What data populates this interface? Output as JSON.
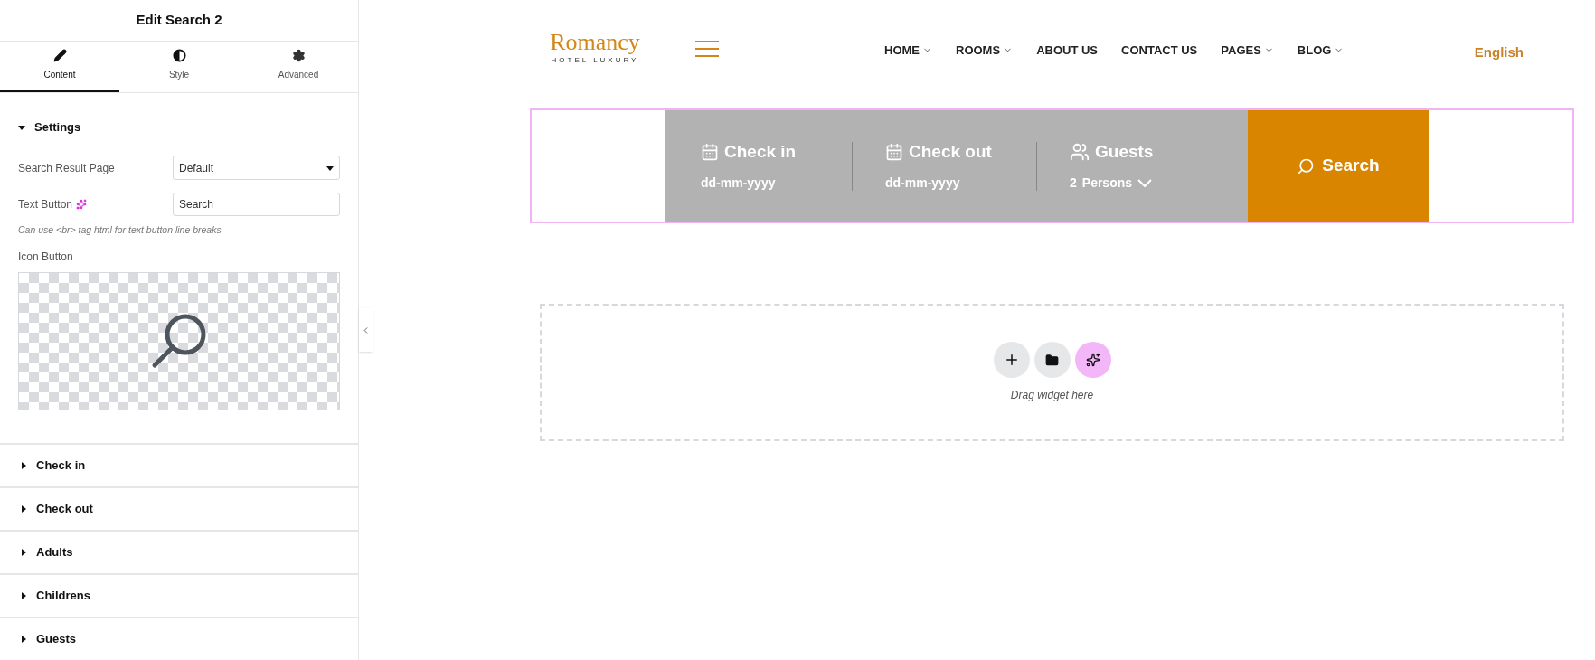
{
  "panel": {
    "title": "Edit Search 2",
    "tabs": [
      {
        "label": "Content",
        "selected": true
      },
      {
        "label": "Style",
        "selected": false
      },
      {
        "label": "Advanced",
        "selected": false
      }
    ],
    "settings": {
      "title": "Settings",
      "expanded": true,
      "search_result_page": {
        "label": "Search Result Page",
        "value": "Default"
      },
      "text_button": {
        "label": "Text Button",
        "value": "Search"
      },
      "hint": "Can use <br> tag html for text button line breaks",
      "icon_button": {
        "label": "Icon Button"
      }
    },
    "sections": [
      {
        "title": "Check in",
        "expanded": false
      },
      {
        "title": "Check out",
        "expanded": false
      },
      {
        "title": "Adults",
        "expanded": false
      },
      {
        "title": "Childrens",
        "expanded": false
      },
      {
        "title": "Guests",
        "expanded": false
      }
    ]
  },
  "site": {
    "logo": {
      "name": "Romancy",
      "tagline": "HOTEL LUXURY"
    },
    "nav": [
      {
        "label": "HOME",
        "dropdown": true
      },
      {
        "label": "ROOMS",
        "dropdown": true
      },
      {
        "label": "ABOUT US",
        "dropdown": false
      },
      {
        "label": "CONTACT US",
        "dropdown": false
      },
      {
        "label": "PAGES",
        "dropdown": true
      },
      {
        "label": "BLOG",
        "dropdown": true
      }
    ],
    "language": "English",
    "booking": {
      "fields": [
        {
          "kind": "date",
          "label": "Check in",
          "value": "dd-mm-yyyy"
        },
        {
          "kind": "date",
          "label": "Check out",
          "value": "dd-mm-yyyy"
        },
        {
          "kind": "guests",
          "label": "Guests",
          "count": "2",
          "value": "Persons"
        }
      ],
      "button": "Search"
    },
    "dropzone": {
      "hint": "Drag widget here"
    }
  }
}
